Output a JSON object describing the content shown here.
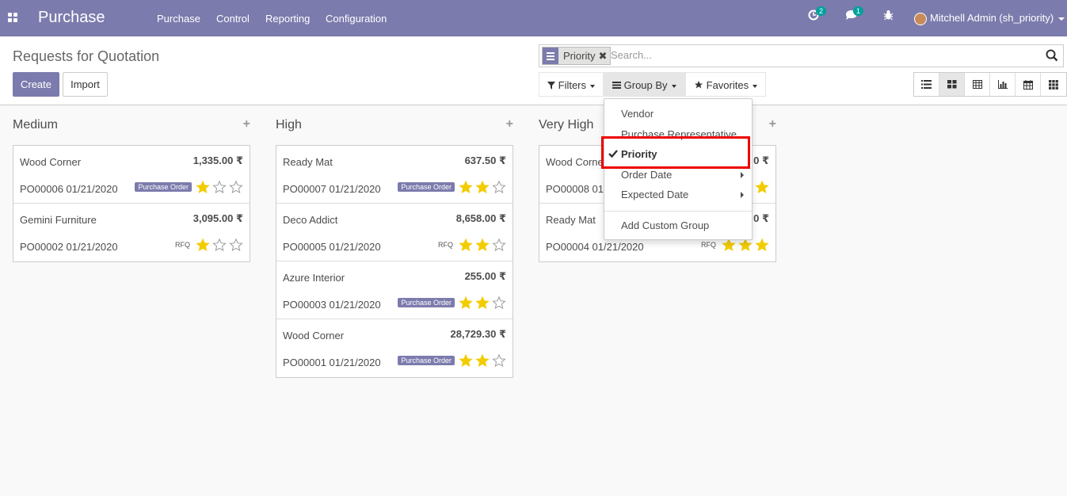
{
  "topbar": {
    "app_title": "Purchase",
    "menu": [
      "Purchase",
      "Control",
      "Reporting",
      "Configuration"
    ],
    "activity_count": "2",
    "messages_count": "1",
    "user": "Mitchell Admin (sh_priority)"
  },
  "control_panel": {
    "title": "Requests for Quotation",
    "create_label": "Create",
    "import_label": "Import",
    "facet_label": "Priority",
    "facet_remove": "✖",
    "search_placeholder": "Search...",
    "filters_label": "Filters",
    "groupby_label": "Group By",
    "favorites_label": "Favorites"
  },
  "groupby_menu": {
    "items": [
      "Vendor",
      "Purchase Representative",
      "Priority",
      "Order Date",
      "Expected Date"
    ],
    "selected": "Priority",
    "custom_label": "Add Custom Group"
  },
  "columns": [
    {
      "title": "Medium",
      "cards": [
        {
          "name": "Wood Corner",
          "amount": "1,335.00 ₹",
          "ref": "PO00006 01/21/2020",
          "status": "Purchase Order",
          "stars": 1
        },
        {
          "name": "Gemini Furniture",
          "amount": "3,095.00 ₹",
          "ref": "PO00002 01/21/2020",
          "status": "RFQ",
          "stars": 1
        }
      ]
    },
    {
      "title": "High",
      "cards": [
        {
          "name": "Ready Mat",
          "amount": "637.50 ₹",
          "ref": "PO00007 01/21/2020",
          "status": "Purchase Order",
          "stars": 2
        },
        {
          "name": "Deco Addict",
          "amount": "8,658.00 ₹",
          "ref": "PO00005 01/21/2020",
          "status": "RFQ",
          "stars": 2
        },
        {
          "name": "Azure Interior",
          "amount": "255.00 ₹",
          "ref": "PO00003 01/21/2020",
          "status": "Purchase Order",
          "stars": 2
        },
        {
          "name": "Wood Corner",
          "amount": "28,729.30 ₹",
          "ref": "PO00001 01/21/2020",
          "status": "Purchase Order",
          "stars": 2
        }
      ]
    },
    {
      "title": "Very High",
      "cards": [
        {
          "name": "Wood Corner",
          "amount": "0 ₹",
          "ref": "PO00008 01",
          "status": "",
          "stars": 3
        },
        {
          "name": "Ready Mat",
          "amount": "0 ₹",
          "ref": "PO00004 01/21/2020",
          "status": "RFQ",
          "stars": 3
        }
      ]
    }
  ],
  "colors": {
    "brand": "#7c7bad",
    "star_on": "#f3cc00",
    "highlight": "#e00000"
  }
}
